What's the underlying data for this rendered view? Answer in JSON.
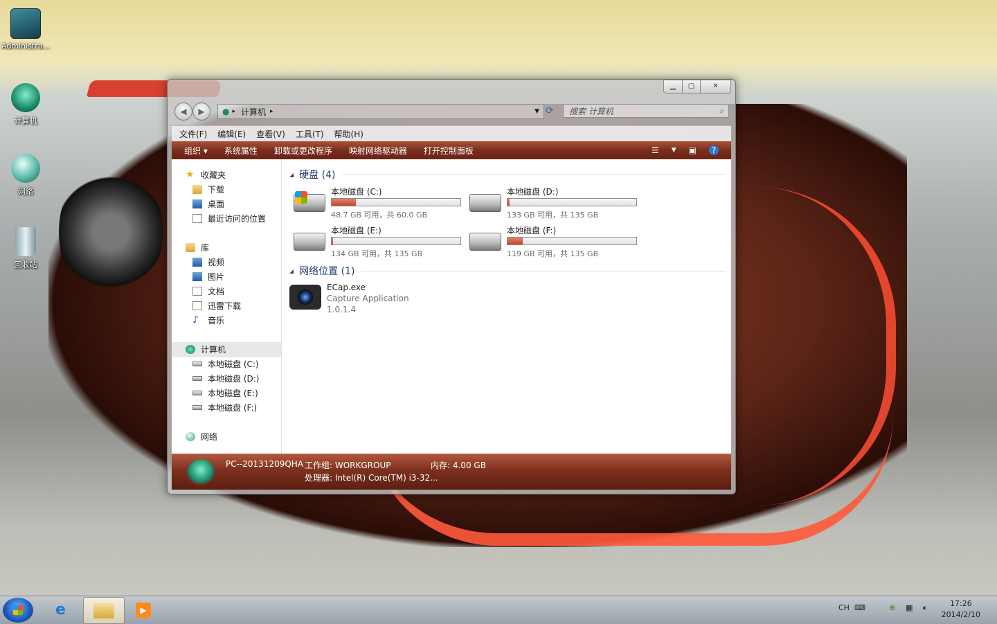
{
  "desktop": {
    "icons": [
      {
        "label": "Administra..."
      },
      {
        "label": "计算机"
      },
      {
        "label": "网络"
      },
      {
        "label": "回收站"
      }
    ]
  },
  "window": {
    "breadcrumb": "计算机",
    "search_placeholder": "搜索 计算机",
    "menu": [
      "文件(F)",
      "编辑(E)",
      "查看(V)",
      "工具(T)",
      "帮助(H)"
    ],
    "commands": [
      "组织 ▾",
      "系统属性",
      "卸载或更改程序",
      "映射网络驱动器",
      "打开控制面板"
    ],
    "sidebar": {
      "favorites": {
        "title": "收藏夹",
        "items": [
          "下载",
          "桌面",
          "最近访问的位置"
        ]
      },
      "libraries": {
        "title": "库",
        "items": [
          "视频",
          "图片",
          "文档",
          "迅雷下载",
          "音乐"
        ]
      },
      "computer": {
        "title": "计算机",
        "items": [
          "本地磁盘 (C:)",
          "本地磁盘 (D:)",
          "本地磁盘 (E:)",
          "本地磁盘 (F:)"
        ]
      },
      "network": {
        "title": "网络"
      }
    },
    "groups": {
      "drives_title": "硬盘 (4)",
      "network_title": "网络位置 (1)"
    },
    "drives": [
      {
        "name": "本地磁盘 (C:)",
        "info": "48.7 GB 可用，共 60.0 GB",
        "used_fraction": 0.19
      },
      {
        "name": "本地磁盘 (D:)",
        "info": "133 GB 可用，共 135 GB",
        "used_fraction": 0.015
      },
      {
        "name": "本地磁盘 (E:)",
        "info": "134 GB 可用，共 135 GB",
        "used_fraction": 0.007
      },
      {
        "name": "本地磁盘 (F:)",
        "info": "119 GB 可用，共 135 GB",
        "used_fraction": 0.12
      }
    ],
    "network_item": {
      "name": "ECap.exe",
      "desc": "Capture Application",
      "version": "1.0.1.4"
    },
    "details": {
      "pc_name": "PC--20131209QHA",
      "workgroup": "工作组: WORKGROUP",
      "memory": "内存: 4.00 GB",
      "cpu": "处理器: Intel(R) Core(TM) i3-32..."
    }
  },
  "taskbar": {
    "lang": "CH",
    "time": "17:26",
    "date": "2014/2/10"
  },
  "colors": {
    "accent": "#7a2d1c",
    "drive_fill": "#c2452c"
  }
}
